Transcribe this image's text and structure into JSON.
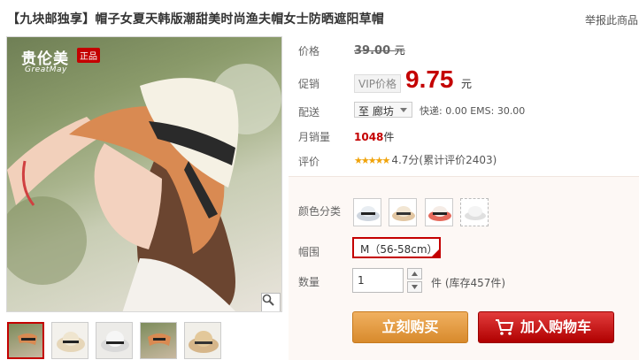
{
  "title": "【九块邮独享】帽子女夏天韩版潮甜美时尚渔夫帽女士防晒遮阳草帽",
  "report_link": "举报此商品",
  "image": {
    "brand": "贵伦美",
    "brand_badge": "正品",
    "brand_sub": "GreatMay"
  },
  "labels": {
    "price": "价格",
    "promo": "促销",
    "shipping": "配送",
    "monthly_sales": "月销量",
    "rating": "评价",
    "color": "颜色分类",
    "size": "帽围",
    "quantity": "数量"
  },
  "price": {
    "original": "39.00",
    "unit": "元",
    "vip_tag": "VIP价格",
    "current": "9.75"
  },
  "shipping": {
    "destination": "至 廊坊",
    "fees": "快递: 0.00 EMS: 30.00"
  },
  "sales": {
    "count": "1048",
    "unit": "件"
  },
  "rating": {
    "stars": "★★★★★",
    "text": "4.7分(累计评价2403)"
  },
  "size_value": "M（56-58cm）",
  "quantity": {
    "value": "1",
    "stock": "件 (库存457件)"
  },
  "buttons": {
    "buy_now": "立刻购买",
    "add_to_cart": "加入购物车"
  },
  "colors": {
    "accent": "#c40000",
    "buy": "#e09a3e",
    "cart": "#c81e1e"
  }
}
